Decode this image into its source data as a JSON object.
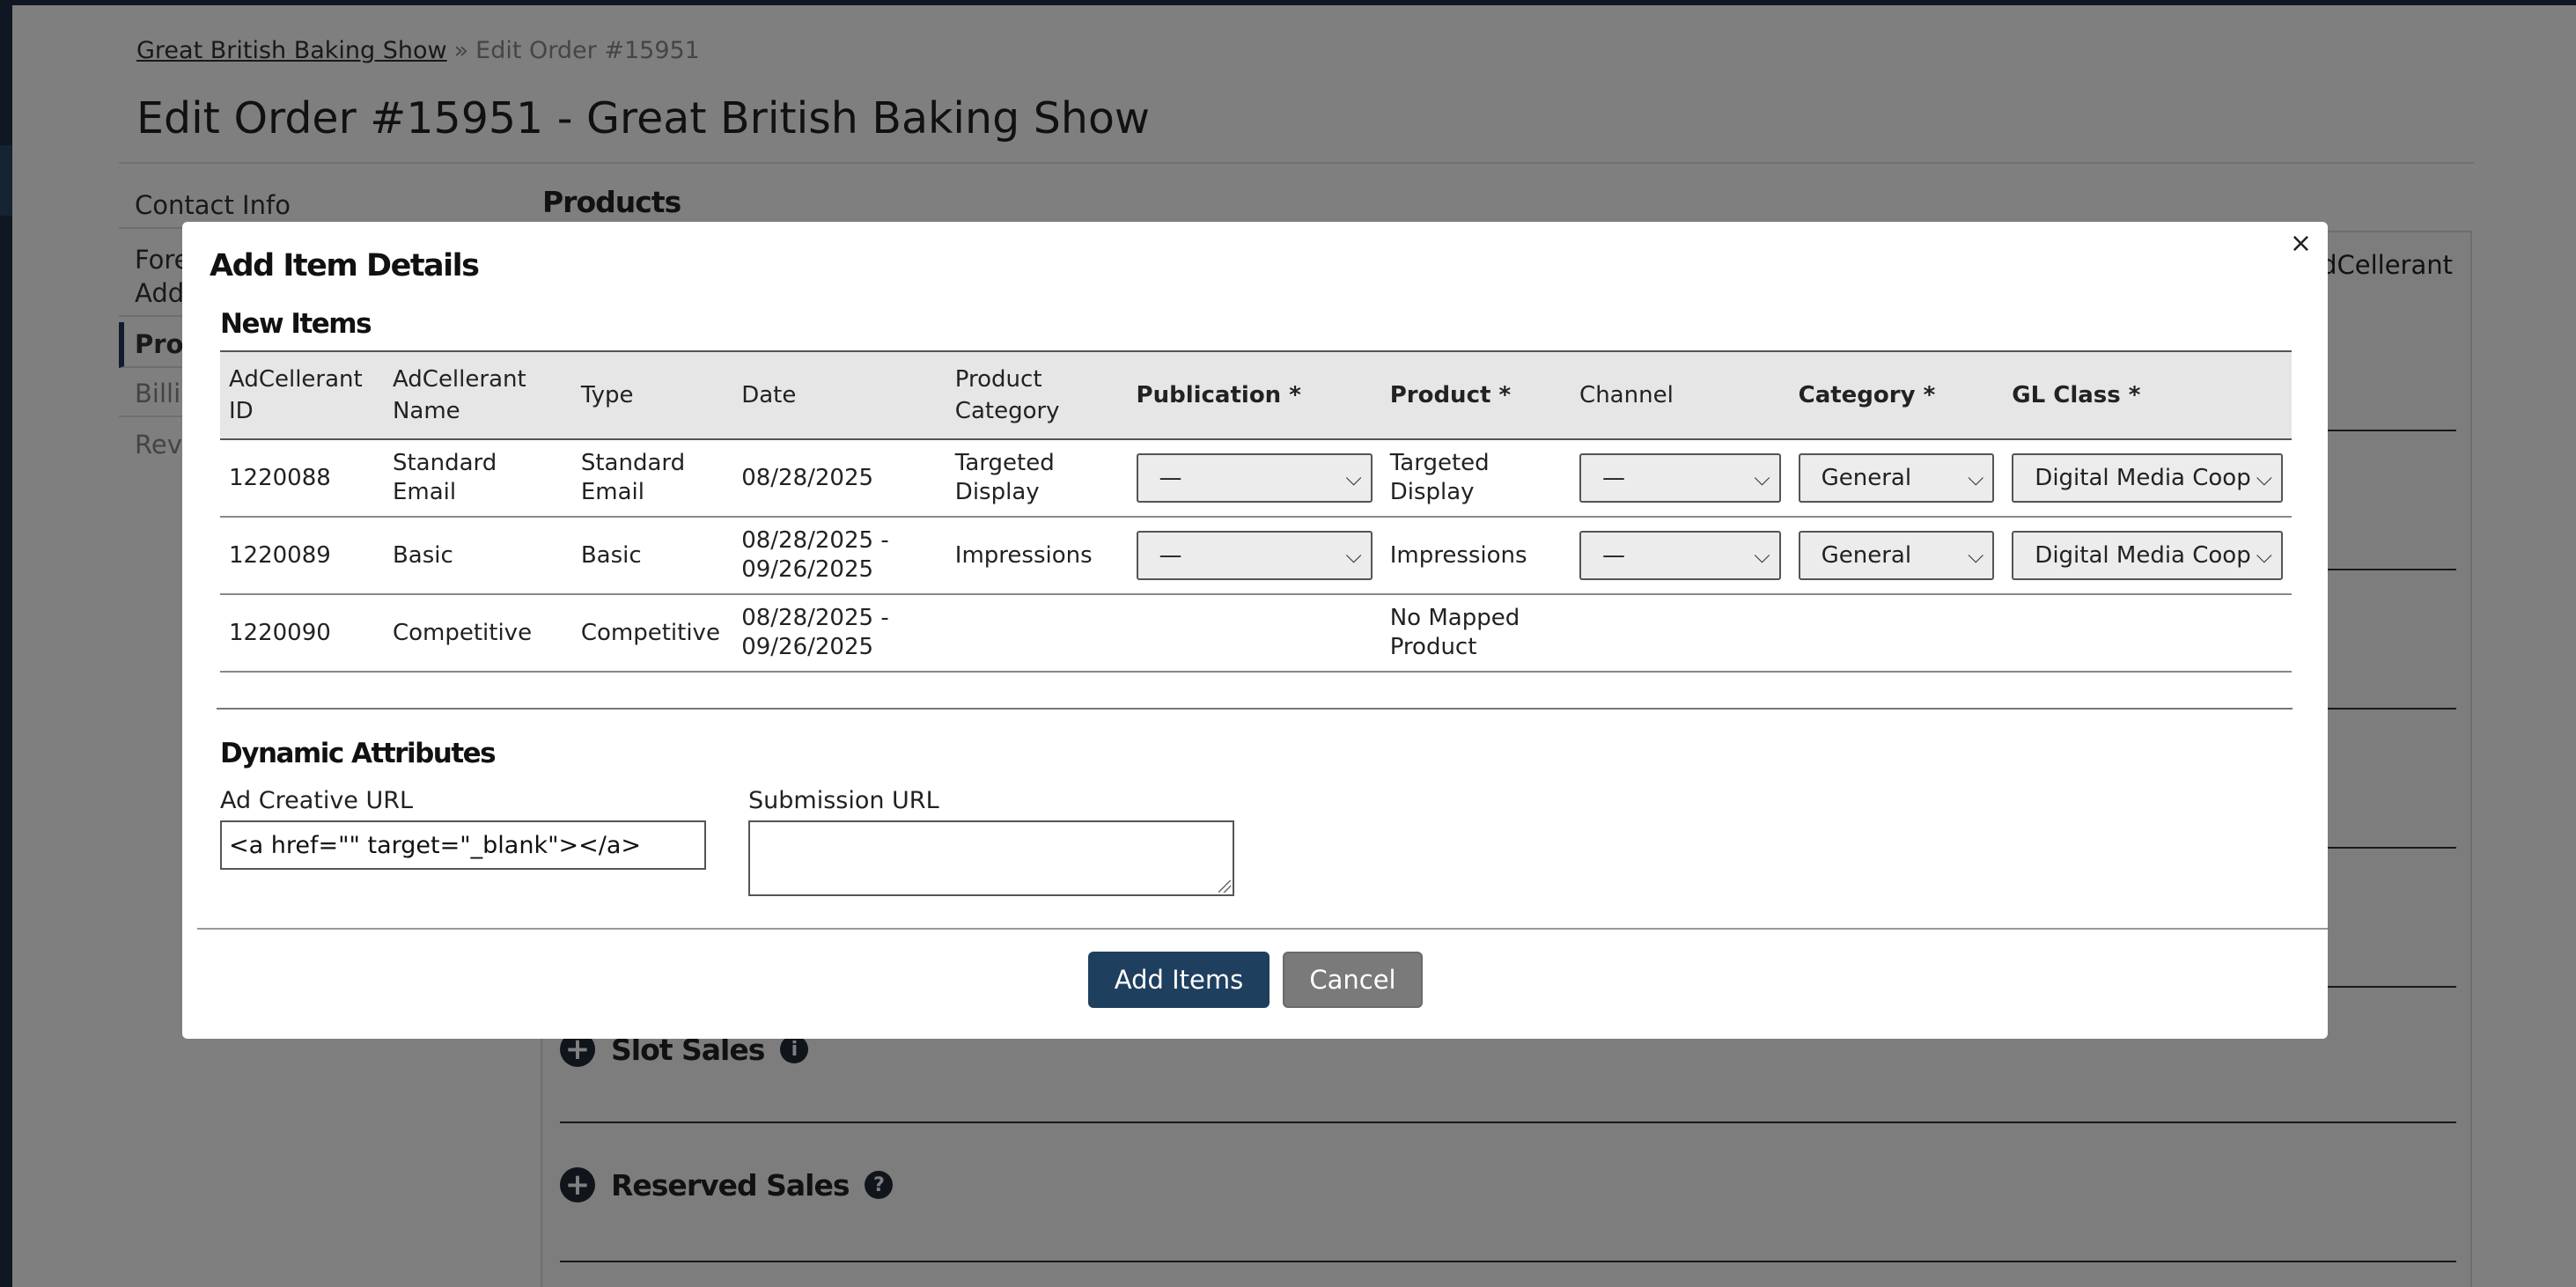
{
  "breadcrumb": {
    "parent": "Great British Baking Show",
    "separator": "»",
    "current": "Edit Order #15951"
  },
  "page_title": "Edit Order #15951 - Great British Baking Show",
  "side_nav": {
    "items": [
      {
        "label": "Contact Info"
      },
      {
        "label": "Forec"
      },
      {
        "label": "Addit"
      },
      {
        "label": "Produ"
      },
      {
        "label": "Billing"
      },
      {
        "label": "Revie"
      }
    ]
  },
  "section_heading": "Products",
  "panel": {
    "right_text": "dCellerant",
    "sections": [
      {
        "title": "Slot Sales"
      },
      {
        "title": "Reserved Sales"
      }
    ]
  },
  "modal": {
    "title": "Add Item Details",
    "close": "×",
    "new_items_heading": "New Items",
    "table": {
      "headers": {
        "id": "AdCellerant ID",
        "name": "AdCellerant Name",
        "type": "Type",
        "date": "Date",
        "product_category": "Product Category",
        "publication": "Publication *",
        "product": "Product *",
        "channel": "Channel",
        "category": "Category *",
        "gl_class": "GL Class *"
      },
      "rows": [
        {
          "id": "1220088",
          "name": "Standard Email",
          "type": "Standard Email",
          "date": "08/28/2025",
          "product_category": "Targeted Display",
          "publication": "—",
          "product": "Targeted Display",
          "channel": "—",
          "category": "General",
          "gl_class": "Digital Media Coop"
        },
        {
          "id": "1220089",
          "name": "Basic",
          "type": "Basic",
          "date": "08/28/2025 - 09/26/2025",
          "product_category": "Impressions",
          "publication": "—",
          "product": "Impressions",
          "channel": "—",
          "category": "General",
          "gl_class": "Digital Media Coop"
        },
        {
          "id": "1220090",
          "name": "Competitive",
          "type": "Competitive",
          "date": "08/28/2025 - 09/26/2025",
          "product_category": "",
          "publication": "",
          "product": "No Mapped Product",
          "channel": "",
          "category": "",
          "gl_class": ""
        }
      ]
    },
    "dynamic_attributes_heading": "Dynamic Attributes",
    "ad_creative_url": {
      "label": "Ad Creative URL",
      "value": "<a href=\"\" target=\"_blank\"></a>"
    },
    "submission_url": {
      "label": "Submission URL",
      "value": ""
    },
    "buttons": {
      "add": "Add Items",
      "cancel": "Cancel"
    }
  },
  "colors": {
    "primary": "#1f3f5f",
    "secondary": "#7a7a7a",
    "app_dark": "#1e2f45"
  }
}
